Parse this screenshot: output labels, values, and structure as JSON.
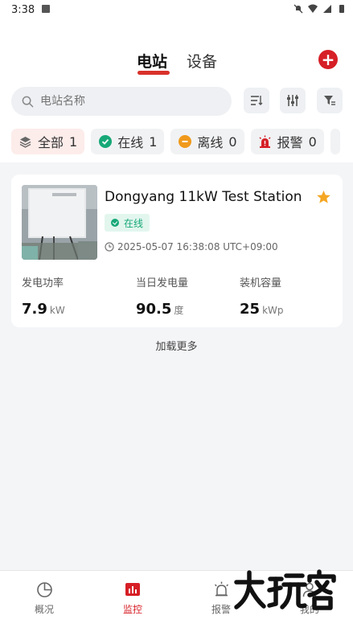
{
  "status_bar": {
    "time": "3:38"
  },
  "header": {
    "tabs": [
      {
        "label": "电站",
        "active": true
      },
      {
        "label": "设备",
        "active": false
      }
    ],
    "add_icon": "plus-circle-icon"
  },
  "search": {
    "placeholder": "电站名称"
  },
  "toolbar": {
    "icons": [
      "sort-icon",
      "sliders-icon",
      "filter-icon"
    ]
  },
  "filters": [
    {
      "label": "全部",
      "count": "1",
      "icon": "layers-icon",
      "active": true
    },
    {
      "label": "在线",
      "count": "1",
      "icon": "check-circle-icon",
      "active": false
    },
    {
      "label": "离线",
      "count": "0",
      "icon": "minus-circle-icon",
      "active": false
    },
    {
      "label": "报警",
      "count": "0",
      "icon": "alarm-icon",
      "active": false
    }
  ],
  "station": {
    "name": "Dongyang 11kW Test Station",
    "status": "在线",
    "timestamp": "2025-05-07 16:38:08 UTC+09:00",
    "favorite": true,
    "metrics": [
      {
        "label": "发电功率",
        "value": "7.9",
        "unit": "kW"
      },
      {
        "label": "当日发电量",
        "value": "90.5",
        "unit": "度"
      },
      {
        "label": "装机容量",
        "value": "25",
        "unit": "kWp"
      }
    ]
  },
  "load_more": "加载更多",
  "bottom_nav": [
    {
      "label": "概况",
      "icon": "pie-chart-icon",
      "active": false
    },
    {
      "label": "监控",
      "icon": "monitor-icon",
      "active": true
    },
    {
      "label": "报警",
      "icon": "alarm-icon",
      "active": false
    },
    {
      "label": "我的",
      "icon": "user-icon",
      "active": false
    }
  ],
  "colors": {
    "accent": "#d61f26",
    "online": "#17a877",
    "star": "#f5a623"
  },
  "watermark_text": "大玩家"
}
